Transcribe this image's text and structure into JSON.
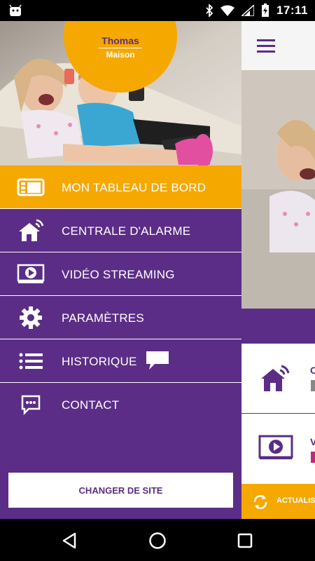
{
  "status_bar": {
    "time": "17:11",
    "icons": [
      "android-icon",
      "bluetooth-icon",
      "wifi-icon",
      "signal-icon",
      "battery-charging-icon"
    ]
  },
  "brand": {
    "name_line1": "Thomas",
    "name_line2": "Maison",
    "primary_color": "#5b2d86",
    "accent_color": "#f5a800"
  },
  "menu": {
    "items": [
      {
        "label": "MON TABLEAU DE BORD",
        "icon": "dashboard-icon",
        "active": true
      },
      {
        "label": "CENTRALE D'ALARME",
        "icon": "smart-home-icon",
        "active": false
      },
      {
        "label": "VIDÉO STREAMING",
        "icon": "video-play-icon",
        "active": false
      },
      {
        "label": "PARAMÈTRES",
        "icon": "gear-icon",
        "active": false
      },
      {
        "label": "HISTORIQUE",
        "icon": "list-icon",
        "active": false,
        "badge_icon": "chat-bubble-icon"
      },
      {
        "label": "CONTACT",
        "icon": "message-icon",
        "active": false
      }
    ],
    "change_site_label": "CHANGER DE SITE"
  },
  "background_screen": {
    "refresh_label": "ACTUALIS",
    "card1_initial": "C",
    "card2_initial": "V"
  },
  "nav_bar": {
    "icons": [
      "back-icon",
      "home-icon",
      "recents-icon"
    ]
  }
}
